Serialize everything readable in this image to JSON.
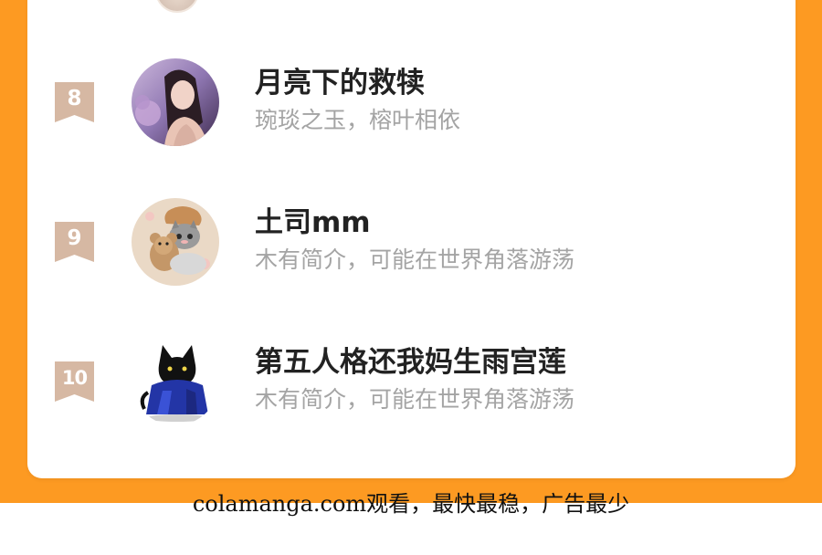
{
  "ranking": {
    "items": [
      {
        "rank": "8",
        "name": "月亮下的救犊",
        "bio": "琬琰之玉，榕叶相依",
        "avatar_icon": "girl-portrait-avatar"
      },
      {
        "rank": "9",
        "name": "土司mm",
        "bio": "木有简介，可能在世界角落游荡",
        "avatar_icon": "cat-with-teddy-bear-avatar"
      },
      {
        "rank": "10",
        "name": "第五人格还我妈生雨宫莲",
        "bio": "木有简介，可能在世界角落游荡",
        "avatar_icon": "black-cat-in-blue-scarf-avatar"
      }
    ]
  },
  "footer": {
    "watermark": "colamanga.com观看，最快最稳，广告最少"
  },
  "colors": {
    "background": "#fd9a22",
    "card": "#ffffff",
    "badge": "#d6b8a3",
    "name": "#222222",
    "bio": "#a4a4a4"
  }
}
